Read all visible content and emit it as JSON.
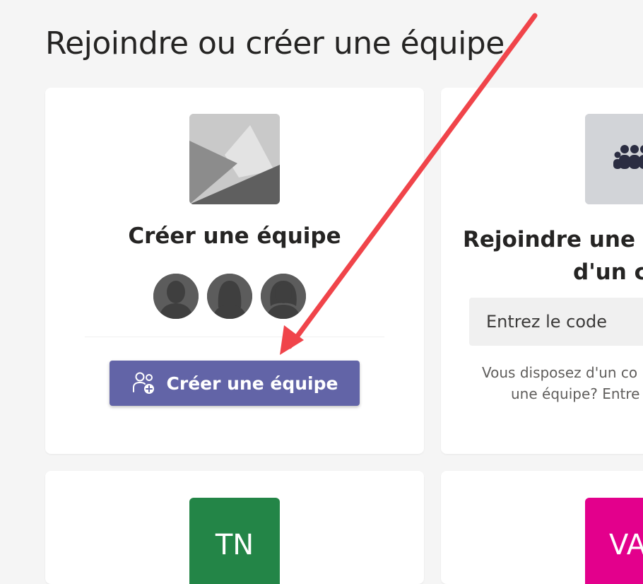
{
  "page": {
    "title": "Rejoindre ou créer une équipe"
  },
  "create_card": {
    "title": "Créer une équipe",
    "button_label": "Créer une équipe"
  },
  "join_card": {
    "title_line1": "Rejoindre une é",
    "title_line2": "d'un c",
    "code_placeholder": "Entrez le code",
    "description_line1": "Vous disposez d'un co",
    "description_line2": "une équipe? Entre"
  },
  "team_tiles": [
    {
      "initials": "TN",
      "color": "#238547"
    },
    {
      "initials": "VA",
      "color": "#e3008c"
    }
  ],
  "colors": {
    "accent": "#6264a7",
    "arrow": "#f0444a"
  }
}
